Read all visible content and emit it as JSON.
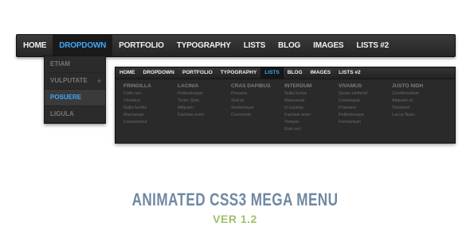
{
  "main_nav": {
    "items": [
      "HOME",
      "DROPDOWN",
      "PORTFOLIO",
      "TYPOGRAPHY",
      "LISTS",
      "BLOG",
      "IMAGES",
      "LISTS #2"
    ],
    "active_index": 1
  },
  "dropdown": {
    "items": [
      "ETIAM",
      "VULPUTATE",
      "POSUERE",
      "LIGULA"
    ],
    "hover_index": 2,
    "submenu_marker": "+"
  },
  "mega_menu": {
    "nav_items": [
      "HOME",
      "DROPDOWN",
      "PORTFOLIO",
      "TYPOGRAPHY",
      "LISTS",
      "BLOG",
      "IMAGES",
      "LISTS #2"
    ],
    "active_index": 4,
    "columns": [
      {
        "heading": "FRINGILLA",
        "links": [
          "Cells nec",
          "Vivamus",
          "Nulla facilisi",
          "Maecenas",
          "Consectetur"
        ]
      },
      {
        "heading": "LACINIA",
        "links": [
          "Pellentesque",
          "Tortor Quis",
          "Aliquam",
          "Facilisis enim"
        ]
      },
      {
        "heading": "CRAS DAPIBUS",
        "links": [
          "Posuere",
          "Sed at",
          "Scelerisque",
          "Commodo"
        ]
      },
      {
        "heading": "INTERDUM",
        "links": [
          "Nulla luctus",
          "Maecenas",
          "In Lacinia",
          "Facilisis enim",
          "Tempor",
          "Erat orci"
        ]
      },
      {
        "heading": "VIVAMUS",
        "links": [
          "Quam eleifend",
          "Consequat",
          "Praesent",
          "Pellentesque",
          "Fermentum"
        ]
      },
      {
        "heading": "JUSTO NIDH",
        "links": [
          "Condimentum",
          "Aliquam at",
          "Tincidunt",
          "Lacus Nunc"
        ]
      }
    ]
  },
  "title": "ANIMATED CSS3 MEGA MENU",
  "version": "VER 1.2",
  "colors": {
    "accent": "#3fa9f5",
    "title": "#6f89a1",
    "version": "#9ec06a",
    "bar": "#2a2a2a"
  }
}
